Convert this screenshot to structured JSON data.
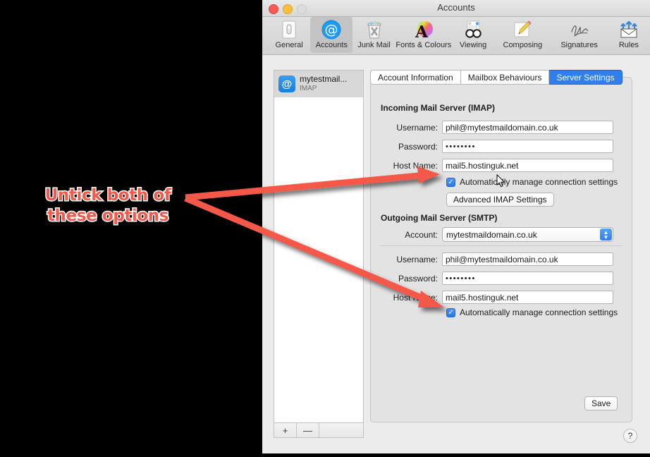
{
  "window": {
    "title": "Accounts",
    "traffic_lights": [
      "close-red",
      "minimize-yellow",
      "zoom-disabled"
    ]
  },
  "toolbar": {
    "items": [
      {
        "label": "General",
        "icon": "general-switch-icon",
        "selected": false
      },
      {
        "label": "Accounts",
        "icon": "at-sign-icon",
        "selected": true
      },
      {
        "label": "Junk Mail",
        "icon": "junk-trash-icon",
        "selected": false
      },
      {
        "label": "Fonts & Colours",
        "icon": "font-colour-icon",
        "selected": false
      },
      {
        "label": "Viewing",
        "icon": "glasses-icon",
        "selected": false
      },
      {
        "label": "Composing",
        "icon": "pencil-note-icon",
        "selected": false
      },
      {
        "label": "Signatures",
        "icon": "signature-icon",
        "selected": false
      },
      {
        "label": "Rules",
        "icon": "rules-envelope-icon",
        "selected": false
      }
    ]
  },
  "sidebar": {
    "account": {
      "name": "mytestmail...",
      "type": "IMAP",
      "icon": "at-sign-icon"
    },
    "footer": {
      "add_label": "+",
      "remove_label": "—"
    }
  },
  "tabs": [
    {
      "label": "Account Information",
      "active": false
    },
    {
      "label": "Mailbox Behaviours",
      "active": false
    },
    {
      "label": "Server Settings",
      "active": true
    }
  ],
  "incoming": {
    "section_title": "Incoming Mail Server (IMAP)",
    "username_label": "Username:",
    "username_value": "phil@mytestmaildomain.co.uk",
    "password_label": "Password:",
    "password_value": "••••••••",
    "hostname_label": "Host Name:",
    "hostname_value": "mail5.hostinguk.net",
    "auto_manage_label": "Automatically manage connection settings",
    "auto_manage_checked": true,
    "advanced_button": "Advanced IMAP Settings"
  },
  "outgoing": {
    "section_title": "Outgoing Mail Server (SMTP)",
    "account_label": "Account:",
    "account_value": "mytestmaildomain.co.uk",
    "username_label": "Username:",
    "username_value": "phil@mytestmaildomain.co.uk",
    "password_label": "Password:",
    "password_value": "••••••••",
    "hostname_label": "Host Name:",
    "hostname_value": "mail5.hostinguk.net",
    "auto_manage_label": "Automatically manage connection settings",
    "auto_manage_checked": true
  },
  "footer": {
    "save_label": "Save",
    "help_label": "?"
  },
  "annotation": {
    "text_line_1": "Untick both of",
    "text_line_2": "these options",
    "text_colour": "#f4584a",
    "outline_colour": "#ffffff",
    "arrow_colour": "#f4584a",
    "arrow_count": 2
  }
}
